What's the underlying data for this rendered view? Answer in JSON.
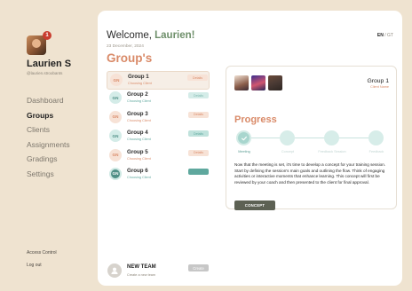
{
  "user": {
    "name": "Laurien S",
    "handle": "@laurien.stroobants",
    "notifications": "1"
  },
  "nav": [
    {
      "label": "Dashboard",
      "active": false
    },
    {
      "label": "Groups",
      "active": true
    },
    {
      "label": "Clients",
      "active": false
    },
    {
      "label": "Assignments",
      "active": false
    },
    {
      "label": "Gradings",
      "active": false
    },
    {
      "label": "Settings",
      "active": false
    }
  ],
  "footer_links": {
    "access_control": "Access Control",
    "logout": "Log out"
  },
  "header": {
    "welcome_prefix": "Welcome,",
    "welcome_name": "Laurien!",
    "date": "23 December, 2024",
    "lang_current": "EN",
    "lang_other": "/ GT",
    "section_title": "Group's"
  },
  "groups": [
    {
      "badge": "GN",
      "name": "Group 1",
      "client": "Choosing Client",
      "status": "Details",
      "active": true
    },
    {
      "badge": "GN",
      "name": "Group 2",
      "client": "Choosing Client",
      "status": "Details",
      "active": false
    },
    {
      "badge": "GN",
      "name": "Group 3",
      "client": "Choosing Client",
      "status": "Details",
      "active": false
    },
    {
      "badge": "GN",
      "name": "Group 4",
      "client": "Choosing Client",
      "status": "Details",
      "active": false
    },
    {
      "badge": "GN",
      "name": "Group 5",
      "client": "Choosing Client",
      "status": "Details",
      "active": false
    },
    {
      "badge": "GN",
      "name": "Group 6",
      "client": "Choosing Client",
      "status": "Details",
      "active": false
    }
  ],
  "colors": {
    "badge_orange_bg": "#f7e2d6",
    "badge_orange_fg": "#d98a68",
    "badge_teal_bg": "#d4ece8",
    "badge_teal_fg": "#4f8f86",
    "badge_teal_dark_bg": "#4f8f86",
    "accent_orange": "#d98a68",
    "accent_green": "#6e8f6a",
    "teal": "#a8d6ce"
  },
  "detail": {
    "group_title": "Group 1",
    "client_label": "Client Name",
    "progress_title": "Progress",
    "steps": [
      {
        "label": "Meeting",
        "done": true
      },
      {
        "label": "Concept",
        "done": false
      },
      {
        "label": "Feedback Session",
        "done": false
      },
      {
        "label": "Feedback",
        "done": false
      }
    ],
    "description": "Now that the meeting is set, it's time to develop a concept for your training session. Start by defining the session's main goals and outlining the flow. Think of engaging activities or interactive moments that enhance learning. This concept will first be reviewed by your coach and then presented to the client for final approval.",
    "button_label": "CONCEPT"
  },
  "new_team": {
    "title": "NEW TEAM",
    "subtitle": "Create a new team",
    "button_label": "Create"
  }
}
